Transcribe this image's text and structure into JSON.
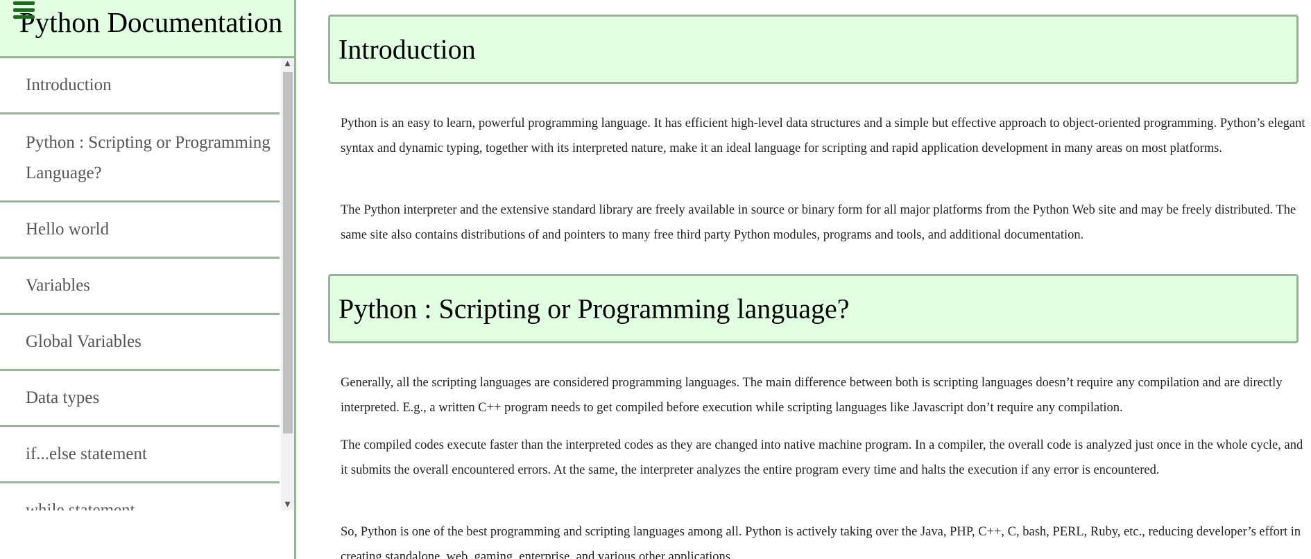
{
  "sidebar": {
    "title": "Python Documentation",
    "menu_icon": "hamburger-menu-icon",
    "items": [
      {
        "label": "Introduction"
      },
      {
        "label": "Python : Scripting or Programming Language?"
      },
      {
        "label": "Hello world"
      },
      {
        "label": "Variables"
      },
      {
        "label": "Global Variables"
      },
      {
        "label": "Data types"
      },
      {
        "label": "if...else statement"
      },
      {
        "label": "while statement"
      }
    ],
    "scroll_up_icon": "▲",
    "scroll_down_icon": "▼"
  },
  "main": {
    "sections": [
      {
        "heading": "Introduction",
        "paragraphs": [
          "Python is an easy to learn, powerful programming language. It has efficient high-level data structures and a simple but effective approach to object-oriented programming. Python’s elegant syntax and dynamic typing, together with its interpreted nature, make it an ideal language for scripting and rapid application development in many areas on most platforms.",
          "The Python interpreter and the extensive standard library are freely available in source or binary form for all major platforms from the Python Web site and may be freely distributed. The same site also contains distributions of and pointers to many free third party Python modules, programs and tools, and additional documentation."
        ]
      },
      {
        "heading": "Python : Scripting or Programming language?",
        "paragraphs": [
          "Generally, all the scripting languages are considered programming languages. The main difference between both is scripting languages doesn’t require any compilation and are directly interpreted. E.g., a written C++ program needs to get compiled before execution while scripting languages like Javascript don’t require any compilation.",
          "The compiled codes execute faster than the interpreted codes as they are changed into native machine program. In a compiler, the overall code is analyzed just once in the whole cycle, and it submits the overall encountered errors. At the same, the interpreter analyzes the entire program every time and halts the execution if any error is encountered.",
          "So, Python is one of the best programming and scripting languages among all. Python is actively taking over the Java, PHP, C++, C, bash, PERL, Ruby, etc., reducing developer’s effort in creating standalone, web, gaming, enterprise, and various other applications."
        ]
      }
    ]
  },
  "colors": {
    "header_bg": "#e1ffe1",
    "border": "#99b399",
    "menu_icon": "#1e6a1e"
  }
}
